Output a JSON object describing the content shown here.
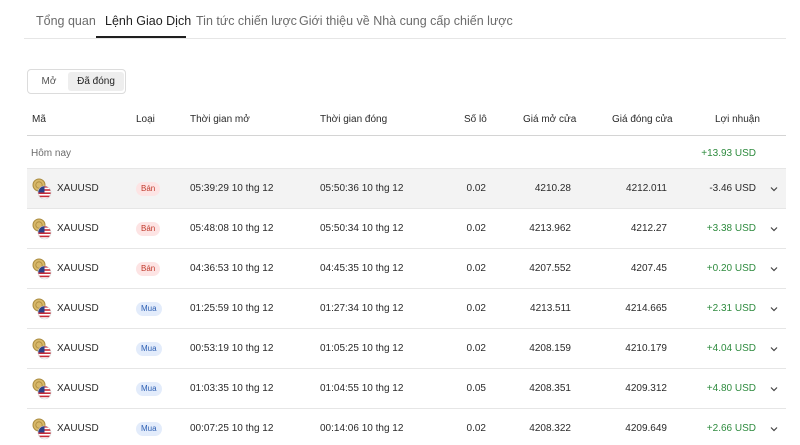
{
  "tabs": [
    {
      "label": "Tổng quan"
    },
    {
      "label": "Lệnh Giao Dịch"
    },
    {
      "label": "Tin tức chiến lược"
    },
    {
      "label": "Giới thiệu về Nhà cung cấp chiến lược"
    }
  ],
  "filter": {
    "open_label": "Mở",
    "closed_label": "Đã đóng",
    "selected": "Đã đóng"
  },
  "columns": {
    "symbol": "Mã",
    "type": "Loại",
    "open_time": "Thời gian mở",
    "close_time": "Thời gian đóng",
    "lots": "Số lô",
    "open_price": "Giá mở cửa",
    "close_price": "Giá đóng cửa",
    "profit": "Lợi nhuận"
  },
  "group": {
    "label": "Hôm nay",
    "total": "+13.93 USD"
  },
  "rows": [
    {
      "symbol": "XAUUSD",
      "type": "Bán",
      "side": "sell",
      "open_time": "05:39:29 10 thg 12",
      "close_time": "05:50:36 10 thg 12",
      "lots": "0.02",
      "open_price": "4210.28",
      "close_price": "4212.011",
      "profit": "-3.46 USD",
      "profit_sign": "neg"
    },
    {
      "symbol": "XAUUSD",
      "type": "Bán",
      "side": "sell",
      "open_time": "05:48:08 10 thg 12",
      "close_time": "05:50:34 10 thg 12",
      "lots": "0.02",
      "open_price": "4213.962",
      "close_price": "4212.27",
      "profit": "+3.38 USD",
      "profit_sign": "pos"
    },
    {
      "symbol": "XAUUSD",
      "type": "Bán",
      "side": "sell",
      "open_time": "04:36:53 10 thg 12",
      "close_time": "04:45:35 10 thg 12",
      "lots": "0.02",
      "open_price": "4207.552",
      "close_price": "4207.45",
      "profit": "+0.20 USD",
      "profit_sign": "pos"
    },
    {
      "symbol": "XAUUSD",
      "type": "Mua",
      "side": "buy",
      "open_time": "01:25:59 10 thg 12",
      "close_time": "01:27:34 10 thg 12",
      "lots": "0.02",
      "open_price": "4213.511",
      "close_price": "4214.665",
      "profit": "+2.31 USD",
      "profit_sign": "pos"
    },
    {
      "symbol": "XAUUSD",
      "type": "Mua",
      "side": "buy",
      "open_time": "00:53:19 10 thg 12",
      "close_time": "01:05:25 10 thg 12",
      "lots": "0.02",
      "open_price": "4208.159",
      "close_price": "4210.179",
      "profit": "+4.04 USD",
      "profit_sign": "pos"
    },
    {
      "symbol": "XAUUSD",
      "type": "Mua",
      "side": "buy",
      "open_time": "01:03:35 10 thg 12",
      "close_time": "01:04:55 10 thg 12",
      "lots": "0.05",
      "open_price": "4208.351",
      "close_price": "4209.312",
      "profit": "+4.80 USD",
      "profit_sign": "pos"
    },
    {
      "symbol": "XAUUSD",
      "type": "Mua",
      "side": "buy",
      "open_time": "00:07:25 10 thg 12",
      "close_time": "00:14:06 10 thg 12",
      "lots": "0.02",
      "open_price": "4208.322",
      "close_price": "4209.649",
      "profit": "+2.66 USD",
      "profit_sign": "pos"
    }
  ],
  "colors": {
    "profit_positive": "#2e8b3e",
    "sell_badge": "#c0392b",
    "buy_badge": "#2d5fb3",
    "highlight_row": "#f3f3f3"
  },
  "icons": {
    "symbol_icon": "gold-coin-us-flag-icon",
    "row_expand": "chevron-down-icon"
  }
}
